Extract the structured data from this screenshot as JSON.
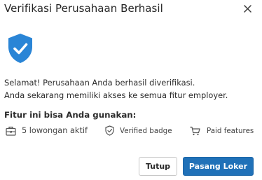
{
  "dialog": {
    "title": "Verifikasi Perusahaan Berhasil",
    "close_icon": "close-icon"
  },
  "status": {
    "icon": "shield-check-icon",
    "color": "#2a85d6"
  },
  "message": {
    "line1": "Selamat! Perusahaan Anda berhasil diverifikasi.",
    "line2": "Anda sekarang memiliki akses ke semua fitur employer."
  },
  "features": {
    "heading": "Fitur ini bisa Anda gunakan:",
    "items": [
      {
        "icon": "briefcase-icon",
        "label": "5 lowongan aktif"
      },
      {
        "icon": "shield-check-outline-icon",
        "label": "Verified badge"
      },
      {
        "icon": "cart-icon",
        "label": "Paid features"
      }
    ]
  },
  "actions": {
    "close_label": "Tutup",
    "post_job_label": "Pasang Loker",
    "primary_color": "#2071b8"
  }
}
